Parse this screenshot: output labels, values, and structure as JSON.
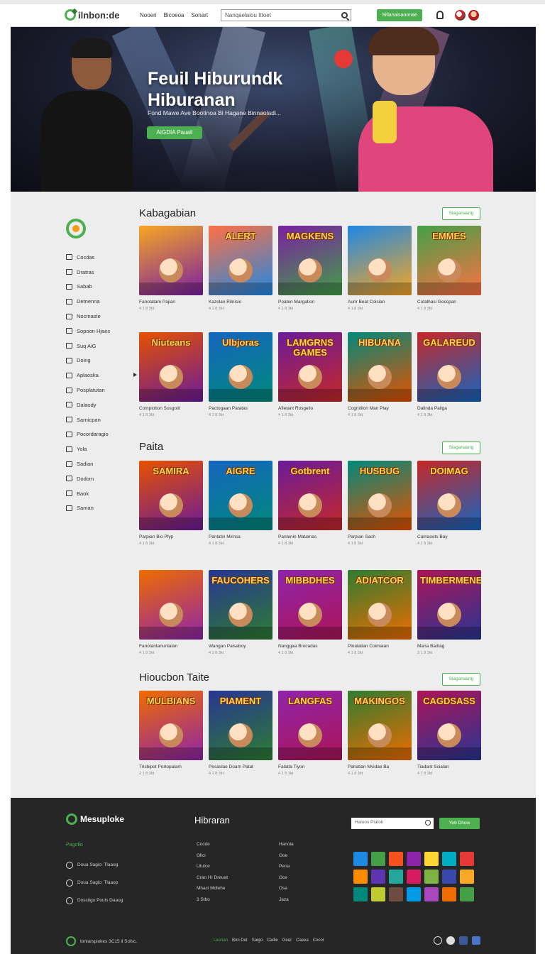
{
  "header": {
    "logo_text": "ilnbon:de",
    "nav": [
      "Nooeri",
      "Bicoeoa",
      "Sonart"
    ],
    "search_placeholder": "Nanqaelaiou Ittoet",
    "button": "Sitlanaisaoonae"
  },
  "hero": {
    "title_line1": "Feuil Hiburundk",
    "title_line2": "Hiburanan",
    "subtitle": "Fond Mawe Ave Bootinoa Bi Hagane Binnaoladi...",
    "button": "AIGDIA Pauali"
  },
  "sidebar": {
    "items": [
      {
        "label": "Cocdas",
        "icon": "monitor-icon"
      },
      {
        "label": "Dratras",
        "icon": "grid-icon"
      },
      {
        "label": "Sabab",
        "icon": "bag-icon"
      },
      {
        "label": "Detnenna",
        "icon": "calendar-icon"
      },
      {
        "label": "Nocmaste",
        "icon": "film-icon"
      },
      {
        "label": "Sopoon Hjaes",
        "icon": "link-icon"
      },
      {
        "label": "Suq AiG",
        "icon": "tag-icon"
      },
      {
        "label": "Doing",
        "icon": "doc-icon"
      },
      {
        "label": "Aplaoska",
        "icon": "page-icon",
        "arrow": true
      },
      {
        "label": "Posplatutan",
        "icon": "brush-icon"
      },
      {
        "label": "Dalaody",
        "icon": "pen-icon"
      },
      {
        "label": "Sarnicpan",
        "icon": "star-icon"
      },
      {
        "label": "Pocordaragio",
        "icon": "image-icon"
      },
      {
        "label": "Yola",
        "icon": "square-icon"
      },
      {
        "label": "Sadian",
        "icon": "book-icon"
      },
      {
        "label": "Dodom",
        "icon": "music-icon"
      },
      {
        "label": "Baok",
        "icon": "chat-icon"
      },
      {
        "label": "Saman",
        "icon": "list-icon"
      }
    ]
  },
  "sections": [
    {
      "title": "Kabagabian",
      "more": "Slaganaang",
      "rows": [
        [
          {
            "title": "Fanotatam Pajian",
            "meta": "4 1 8 3kt",
            "art": ""
          },
          {
            "title": "Kazolan Rilnisio",
            "meta": "4 1 8 3kt",
            "art": "ALERT"
          },
          {
            "title": "Poaten Margation",
            "meta": "4 1 8 3kt",
            "art": "MAGKENS"
          },
          {
            "title": "Aurir Beat Coisian",
            "meta": "4 1 8 3kt",
            "art": ""
          },
          {
            "title": "Cutalhasi Goccpan",
            "meta": "4 1 8 3kt",
            "art": "EMMES"
          }
        ],
        [
          {
            "title": "Compiotion Sosgolit",
            "meta": "4 1 8 3kt",
            "art": "Niuteans"
          },
          {
            "title": "Pactogaan Patatas",
            "meta": "4 1 8 3kt",
            "art": "Ulbjoras"
          },
          {
            "title": "Afietant Rosgelio",
            "meta": "4 1 8 3kt",
            "art": "LAMGRNS GAMES"
          },
          {
            "title": "Cognitilon Man Play",
            "meta": "4 1 8 3kt",
            "art": "HIBUANA"
          },
          {
            "title": "Dalinda Paliga",
            "meta": "4 1 8 3kt",
            "art": "GALAREUD"
          }
        ]
      ]
    },
    {
      "title": "Paita",
      "more": "Slaganaang",
      "rows": [
        [
          {
            "title": "Parpian Bio Pfyp",
            "meta": "4 1 8 3kt",
            "art": "SAMIRA"
          },
          {
            "title": "Panlatin Mirnsa",
            "meta": "4 1 8 3kt",
            "art": "AIGRE"
          },
          {
            "title": "Pantenin Matamas",
            "meta": "4 1 8 3kt",
            "art": "Gotbrent"
          },
          {
            "title": "Parpian Sach",
            "meta": "4 1 8 3kt",
            "art": "HUSBUG"
          },
          {
            "title": "Camaoets Bay",
            "meta": "4 1 8 3kt",
            "art": "DOIMAG"
          }
        ],
        [
          {
            "title": "Fanotantanuntalan",
            "meta": "4 1 8 3kt",
            "art": ""
          },
          {
            "title": "Wangan Paisaboy",
            "meta": "4 1 8 3kt",
            "art": "FAUCOHERS"
          },
          {
            "title": "Nanggaa Brocadas",
            "meta": "4 1 8 3kt",
            "art": "MIBBDHES"
          },
          {
            "title": "Pinalatian Coimaian",
            "meta": "4 1 8 3kt",
            "art": "ADIATCOR"
          },
          {
            "title": "Mana Badlag",
            "meta": "3 1 8 3kt",
            "art": "TIMBERMENE"
          }
        ]
      ]
    },
    {
      "title": "Hioucbon Taite",
      "more": "Slaganaang",
      "rows": [
        [
          {
            "title": "Trisbipot Portopalam",
            "meta": "2 1 8 3kt",
            "art": "MULBIANS"
          },
          {
            "title": "Pesaslae Doam Patat",
            "meta": "4 1 8 3kt",
            "art": "PIAMENT"
          },
          {
            "title": "Fatatla Tiyon",
            "meta": "4 1 8 3kt",
            "art": "LANGFAS"
          },
          {
            "title": "Pahatian Mvidae Ba",
            "meta": "4 1 8 3kt",
            "art": "MAKINGOS"
          },
          {
            "title": "Tiadant Scialan",
            "meta": "4 1 8 3kt",
            "art": "CAGDSASS"
          }
        ]
      ]
    }
  ],
  "footer": {
    "logo_text": "Mesuploke",
    "heading": "Hibraran",
    "green_label": "Pagofio",
    "links": [
      "Doua Sagio: Tlaaog",
      "Doua Saglo: Tlaaop",
      "Dosstigo Pouls Daaog"
    ],
    "col1": [
      "Cocde",
      "Ollci",
      "Lllutce",
      "Cran Hr Dreuat",
      "Mhaci Mdlehe",
      "3 Stbo"
    ],
    "col2": [
      "Hanola",
      "Ooe",
      "Pena",
      "Oce",
      "Osa",
      "Jaza"
    ],
    "search_placeholder": "Haiuos Platok",
    "button": "Yeb Dhow",
    "copyright": "tonlarspiokes 3C15 il Sohic.",
    "bottom_menu": [
      "Leonan",
      "Bon Det",
      "Saigo",
      "Cadie",
      "Geer",
      "Caeea",
      "Cocol"
    ]
  }
}
